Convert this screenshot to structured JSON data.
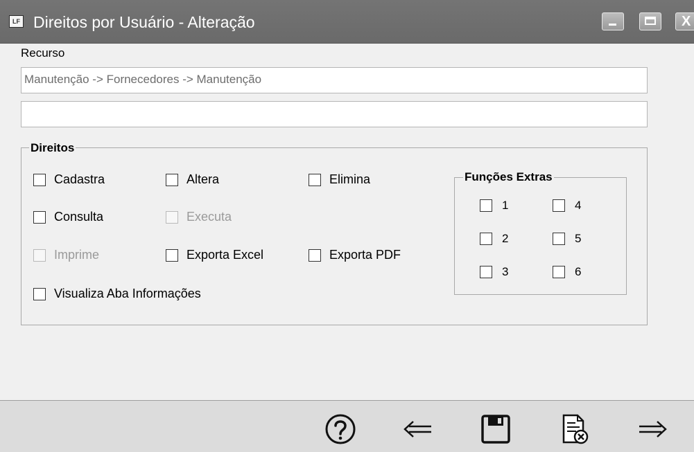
{
  "window": {
    "app_icon_text": "LF",
    "title": "Direitos por Usuário - Alteração",
    "close_glyph": "X"
  },
  "recurso": {
    "label": "Recurso",
    "field1_value": "Manutenção -> Fornecedores -> Manutenção",
    "field2_value": ""
  },
  "direitos": {
    "legend": "Direitos",
    "cadastra": "Cadastra",
    "altera": "Altera",
    "elimina": "Elimina",
    "consulta": "Consulta",
    "executa": "Executa",
    "imprime": "Imprime",
    "exporta_excel": "Exporta Excel",
    "exporta_pdf": "Exporta PDF",
    "visualiza_aba": "Visualiza Aba Informações"
  },
  "funcoes_extras": {
    "legend": "Funções Extras",
    "items": [
      "1",
      "2",
      "3",
      "4",
      "5",
      "6"
    ]
  },
  "toolbar": {
    "icons": [
      "help-icon",
      "back-arrow-icon",
      "save-icon",
      "cancel-document-icon",
      "next-arrow-icon"
    ]
  }
}
